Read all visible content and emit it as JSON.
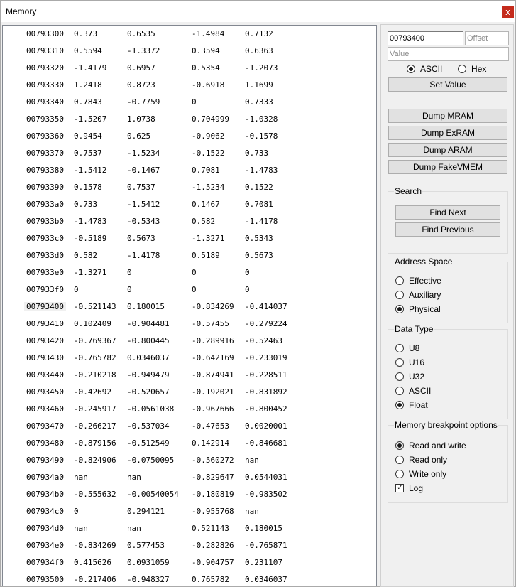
{
  "window": {
    "title": "Memory",
    "close_glyph": "x"
  },
  "memory": {
    "selected_row": 16,
    "rows": [
      {
        "addr": "00793300",
        "v": [
          "0.373",
          "0.6535",
          "-1.4984",
          "0.7132"
        ]
      },
      {
        "addr": "00793310",
        "v": [
          "0.5594",
          "-1.3372",
          "0.3594",
          "0.6363"
        ]
      },
      {
        "addr": "00793320",
        "v": [
          "-1.4179",
          "0.6957",
          "0.5354",
          "-1.2073"
        ]
      },
      {
        "addr": "00793330",
        "v": [
          "1.2418",
          "0.8723",
          "-0.6918",
          "1.1699"
        ]
      },
      {
        "addr": "00793340",
        "v": [
          "0.7843",
          "-0.7759",
          "0",
          "0.7333"
        ]
      },
      {
        "addr": "00793350",
        "v": [
          "-1.5207",
          "1.0738",
          "0.704999",
          "-1.0328"
        ]
      },
      {
        "addr": "00793360",
        "v": [
          "0.9454",
          "0.625",
          "-0.9062",
          "-0.1578"
        ]
      },
      {
        "addr": "00793370",
        "v": [
          "0.7537",
          "-1.5234",
          "-0.1522",
          "0.733"
        ]
      },
      {
        "addr": "00793380",
        "v": [
          "-1.5412",
          "-0.1467",
          "0.7081",
          "-1.4783"
        ]
      },
      {
        "addr": "00793390",
        "v": [
          "0.1578",
          "0.7537",
          "-1.5234",
          "0.1522"
        ]
      },
      {
        "addr": "007933a0",
        "v": [
          "0.733",
          "-1.5412",
          "0.1467",
          "0.7081"
        ]
      },
      {
        "addr": "007933b0",
        "v": [
          "-1.4783",
          "-0.5343",
          "0.582",
          "-1.4178"
        ]
      },
      {
        "addr": "007933c0",
        "v": [
          "-0.5189",
          "0.5673",
          "-1.3271",
          "0.5343"
        ]
      },
      {
        "addr": "007933d0",
        "v": [
          "0.582",
          "-1.4178",
          "0.5189",
          "0.5673"
        ]
      },
      {
        "addr": "007933e0",
        "v": [
          "-1.3271",
          "0",
          "0",
          "0"
        ]
      },
      {
        "addr": "007933f0",
        "v": [
          "0",
          "0",
          "0",
          "0"
        ]
      },
      {
        "addr": "00793400",
        "v": [
          "-0.521143",
          "0.180015",
          "-0.834269",
          "-0.414037"
        ]
      },
      {
        "addr": "00793410",
        "v": [
          "0.102409",
          "-0.904481",
          "-0.57455",
          "-0.279224"
        ]
      },
      {
        "addr": "00793420",
        "v": [
          "-0.769367",
          "-0.800445",
          "-0.289916",
          "-0.52463"
        ]
      },
      {
        "addr": "00793430",
        "v": [
          "-0.765782",
          "0.0346037",
          "-0.642169",
          "-0.233019"
        ]
      },
      {
        "addr": "00793440",
        "v": [
          "-0.210218",
          "-0.949479",
          "-0.874941",
          "-0.228511"
        ]
      },
      {
        "addr": "00793450",
        "v": [
          "-0.42692",
          "-0.520657",
          "-0.192021",
          "-0.831892"
        ]
      },
      {
        "addr": "00793460",
        "v": [
          "-0.245917",
          "-0.0561038",
          "-0.967666",
          "-0.800452"
        ]
      },
      {
        "addr": "00793470",
        "v": [
          "-0.266217",
          "-0.537034",
          "-0.47653",
          "0.0020001"
        ]
      },
      {
        "addr": "00793480",
        "v": [
          "-0.879156",
          "-0.512549",
          "0.142914",
          "-0.846681"
        ]
      },
      {
        "addr": "00793490",
        "v": [
          "-0.824906",
          "-0.0750095",
          "-0.560272",
          "nan"
        ]
      },
      {
        "addr": "007934a0",
        "v": [
          "nan",
          "nan",
          "-0.829647",
          "0.0544031"
        ]
      },
      {
        "addr": "007934b0",
        "v": [
          "-0.555632",
          "-0.00540054",
          "-0.180819",
          "-0.983502"
        ]
      },
      {
        "addr": "007934c0",
        "v": [
          "0",
          "0.294121",
          "-0.955768",
          "nan"
        ]
      },
      {
        "addr": "007934d0",
        "v": [
          "nan",
          "nan",
          "0.521143",
          "0.180015"
        ]
      },
      {
        "addr": "007934e0",
        "v": [
          "-0.834269",
          "0.577453",
          "-0.282826",
          "-0.765871"
        ]
      },
      {
        "addr": "007934f0",
        "v": [
          "0.415626",
          "0.0931059",
          "-0.904757",
          "0.231107"
        ]
      },
      {
        "addr": "00793500",
        "v": [
          "-0.217406",
          "-0.948327",
          "0.765782",
          "0.0346037"
        ]
      }
    ]
  },
  "panel": {
    "address_value": "00793400",
    "offset_placeholder": "Offset",
    "value_placeholder": "Value",
    "encoding": {
      "ascii": "ASCII",
      "hex": "Hex",
      "selected": "ascii"
    },
    "set_value": "Set Value",
    "dump": {
      "mram": "Dump MRAM",
      "exram": "Dump ExRAM",
      "aram": "Dump ARAM",
      "fakevmem": "Dump FakeVMEM"
    },
    "search": {
      "title": "Search",
      "find_next": "Find Next",
      "find_previous": "Find Previous"
    },
    "address_space": {
      "title": "Address Space",
      "effective": "Effective",
      "auxiliary": "Auxiliary",
      "physical": "Physical",
      "selected": "physical"
    },
    "data_type": {
      "title": "Data Type",
      "u8": "U8",
      "u16": "U16",
      "u32": "U32",
      "ascii": "ASCII",
      "float": "Float",
      "selected": "float"
    },
    "breakpoint": {
      "title": "Memory breakpoint options",
      "read_write": "Read and write",
      "read_only": "Read only",
      "write_only": "Write only",
      "log": "Log",
      "selected": "read_write",
      "log_checked": true
    }
  }
}
